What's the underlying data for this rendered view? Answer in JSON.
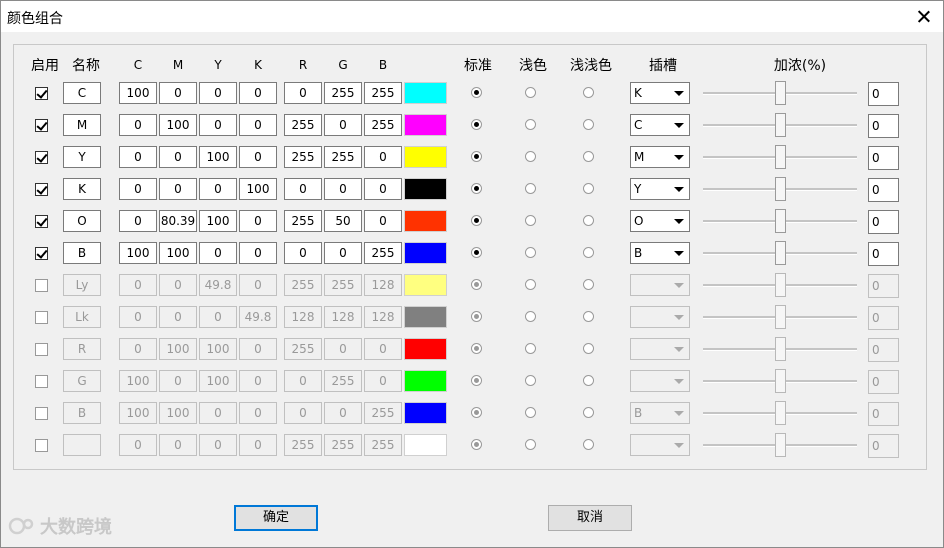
{
  "window": {
    "title": "颜色组合"
  },
  "headers": {
    "enable": "启用",
    "name": "名称",
    "c": "C",
    "m": "M",
    "y": "Y",
    "k": "K",
    "r": "R",
    "g": "G",
    "b": "B",
    "standard": "标准",
    "light": "浅色",
    "lighter": "浅浅色",
    "slot": "插槽",
    "boost": "加浓(%)"
  },
  "rows": [
    {
      "enabled": true,
      "name": "C",
      "c": "100",
      "m": "0",
      "y": "0",
      "k": "0",
      "r": "0",
      "g": "255",
      "b": "255",
      "color": "#00ffff",
      "mode": 0,
      "slot": "K",
      "slider": 0.5,
      "boost": "0"
    },
    {
      "enabled": true,
      "name": "M",
      "c": "0",
      "m": "100",
      "y": "0",
      "k": "0",
      "r": "255",
      "g": "0",
      "b": "255",
      "color": "#ff00ff",
      "mode": 0,
      "slot": "C",
      "slider": 0.5,
      "boost": "0"
    },
    {
      "enabled": true,
      "name": "Y",
      "c": "0",
      "m": "0",
      "y": "100",
      "k": "0",
      "r": "255",
      "g": "255",
      "b": "0",
      "color": "#ffff00",
      "mode": 0,
      "slot": "M",
      "slider": 0.5,
      "boost": "0"
    },
    {
      "enabled": true,
      "name": "K",
      "c": "0",
      "m": "0",
      "y": "0",
      "k": "100",
      "r": "0",
      "g": "0",
      "b": "0",
      "color": "#000000",
      "mode": 0,
      "slot": "Y",
      "slider": 0.5,
      "boost": "0"
    },
    {
      "enabled": true,
      "name": "O",
      "c": "0",
      "m": "80.39",
      "y": "100",
      "k": "0",
      "r": "255",
      "g": "50",
      "b": "0",
      "color": "#ff3200",
      "mode": 0,
      "slot": "O",
      "slider": 0.5,
      "boost": "0"
    },
    {
      "enabled": true,
      "name": "B",
      "c": "100",
      "m": "100",
      "y": "0",
      "k": "0",
      "r": "0",
      "g": "0",
      "b": "255",
      "color": "#0000ff",
      "mode": 0,
      "slot": "B",
      "slider": 0.5,
      "boost": "0"
    },
    {
      "enabled": false,
      "name": "Ly",
      "c": "0",
      "m": "0",
      "y": "49.8",
      "k": "0",
      "r": "255",
      "g": "255",
      "b": "128",
      "color": "#ffff80",
      "mode": 0,
      "slot": "",
      "slider": 0.5,
      "boost": "0"
    },
    {
      "enabled": false,
      "name": "Lk",
      "c": "0",
      "m": "0",
      "y": "0",
      "k": "49.8",
      "r": "128",
      "g": "128",
      "b": "128",
      "color": "#808080",
      "mode": 0,
      "slot": "",
      "slider": 0.5,
      "boost": "0"
    },
    {
      "enabled": false,
      "name": "R",
      "c": "0",
      "m": "100",
      "y": "100",
      "k": "0",
      "r": "255",
      "g": "0",
      "b": "0",
      "color": "#ff0000",
      "mode": 0,
      "slot": "",
      "slider": 0.5,
      "boost": "0"
    },
    {
      "enabled": false,
      "name": "G",
      "c": "100",
      "m": "0",
      "y": "100",
      "k": "0",
      "r": "0",
      "g": "255",
      "b": "0",
      "color": "#00ff00",
      "mode": 0,
      "slot": "",
      "slider": 0.5,
      "boost": "0"
    },
    {
      "enabled": false,
      "name": "B",
      "c": "100",
      "m": "100",
      "y": "0",
      "k": "0",
      "r": "0",
      "g": "0",
      "b": "255",
      "color": "#0000ff",
      "mode": 0,
      "slot": "B",
      "slider": 0.5,
      "boost": "0"
    },
    {
      "enabled": false,
      "name": "",
      "c": "0",
      "m": "0",
      "y": "0",
      "k": "0",
      "r": "255",
      "g": "255",
      "b": "255",
      "color": "#ffffff",
      "mode": 0,
      "slot": "",
      "slider": 0.5,
      "boost": "0"
    }
  ],
  "buttons": {
    "ok": "确定",
    "cancel": "取消"
  },
  "watermark": "大数跨境"
}
